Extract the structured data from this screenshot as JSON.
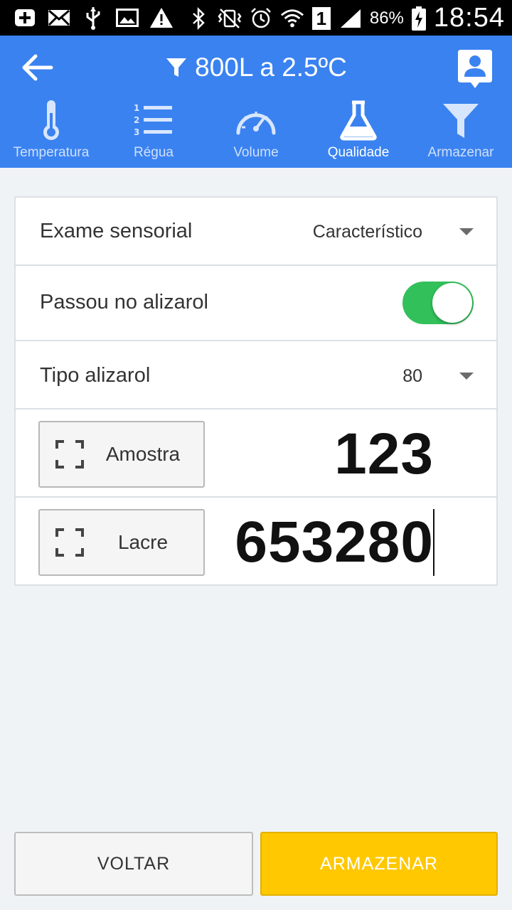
{
  "status_bar": {
    "battery_percent": "86%",
    "time": "18:54",
    "sim_slot": "1",
    "icons": [
      "plus-box-icon",
      "mail-icon",
      "usb-icon",
      "image-icon",
      "warning-icon",
      "bluetooth-icon",
      "vibrate-icon",
      "alarm-icon",
      "wifi-icon",
      "signal-icon",
      "battery-charging-icon"
    ]
  },
  "app_bar": {
    "title": "800L a 2.5ºC",
    "title_icon": "filter-icon",
    "back_icon": "arrow-left-icon",
    "profile_icon": "user-badge-icon"
  },
  "tabs": [
    {
      "label": "Temperatura",
      "icon": "thermometer-icon",
      "active": false
    },
    {
      "label": "Régua",
      "icon": "numbered-list-icon",
      "active": false
    },
    {
      "label": "Volume",
      "icon": "gauge-icon",
      "active": false
    },
    {
      "label": "Qualidade",
      "icon": "flask-icon",
      "active": true
    },
    {
      "label": "Armazenar",
      "icon": "filter-icon",
      "active": false
    }
  ],
  "form": {
    "exame_label": "Exame sensorial",
    "exame_value": "Característico",
    "alizarol_label": "Passou no alizarol",
    "alizarol_on": true,
    "tipo_label": "Tipo alizarol",
    "tipo_value": "80",
    "amostra_button": "Amostra",
    "amostra_value": "123",
    "lacre_button": "Lacre",
    "lacre_value": "653280"
  },
  "buttons": {
    "back_label": "VOLTAR",
    "store_label": "ARMAZENAR"
  },
  "colors": {
    "app_bar": "#3a82f0",
    "toggle_on": "#32c05a",
    "primary_button": "#ffc800"
  }
}
